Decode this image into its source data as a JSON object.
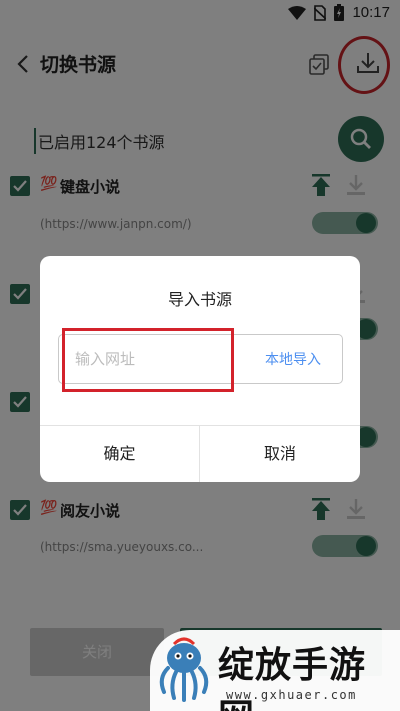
{
  "status_bar": {
    "time": "10:17"
  },
  "header": {
    "title": "切换书源",
    "back_icon": "chevron-left-icon",
    "copy_icon": "copy-check-icon",
    "download_icon": "download-icon"
  },
  "search": {
    "value": "已启用124个书源"
  },
  "sources": [
    {
      "emoji": "💯",
      "name": "键盘小说",
      "url": "(https://www.janpn.com/)"
    },
    {
      "emoji": "💯",
      "name": "",
      "url": ""
    },
    {
      "emoji": "💯",
      "name": "",
      "url": ""
    },
    {
      "emoji": "💯",
      "name": "阅友小说",
      "url": "(https://sma.yueyouxs.co..."
    }
  ],
  "footer": {
    "close_label": "关闭"
  },
  "dialog": {
    "title": "导入书源",
    "url_placeholder": "输入网址",
    "local_import": "本地导入",
    "confirm": "确定",
    "cancel": "取消"
  },
  "watermark": {
    "text": "绽放手游网",
    "url": "www.gxhuaer.com"
  },
  "colors": {
    "accent": "#2e6f57",
    "highlight_red": "#d3222b",
    "link_blue": "#4d8ff0"
  }
}
